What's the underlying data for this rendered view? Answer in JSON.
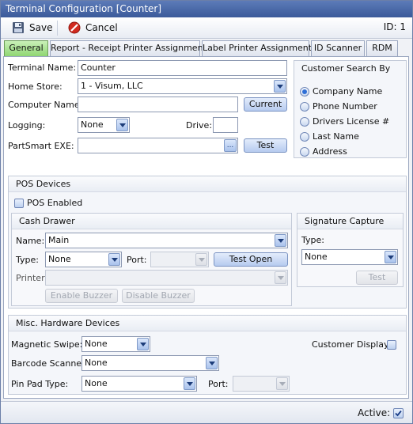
{
  "window": {
    "title": "Terminal Configuration [Counter]"
  },
  "toolbar": {
    "save_label": "Save",
    "cancel_label": "Cancel",
    "id_label": "ID: 1"
  },
  "tabs": [
    {
      "label": "General",
      "active": true
    },
    {
      "label": "Report - Receipt Printer Assignments"
    },
    {
      "label": "Label Printer Assignments"
    },
    {
      "label": "ID Scanner"
    },
    {
      "label": "RDM"
    }
  ],
  "general": {
    "terminal_name_label": "Terminal Name:",
    "terminal_name_value": "Counter",
    "home_store_label": "Home Store:",
    "home_store_value": "1 - Visum, LLC",
    "computer_name_label": "Computer Name:",
    "computer_name_value": "",
    "current_button": "Current",
    "logging_label": "Logging:",
    "logging_value": "None",
    "drive_label": "Drive:",
    "drive_value": "",
    "partsmart_label": "PartSmart EXE:",
    "partsmart_value": "",
    "browse_button": "...",
    "test_button": "Test"
  },
  "customer_search": {
    "title": "Customer Search By",
    "options": [
      "Company Name",
      "Phone Number",
      "Drivers License #",
      "Last Name",
      "Address"
    ],
    "selected": "Company Name"
  },
  "pos_devices": {
    "title": "POS Devices",
    "pos_enabled_label": "POS Enabled",
    "cash_drawer": {
      "title": "Cash Drawer",
      "name_label": "Name:",
      "name_value": "Main",
      "type_label": "Type:",
      "type_value": "None",
      "port_label": "Port:",
      "port_value": "",
      "test_open_button": "Test Open",
      "printer_label": "Printer:",
      "printer_value": "",
      "enable_buzzer_button": "Enable Buzzer",
      "disable_buzzer_button": "Disable Buzzer"
    },
    "signature_capture": {
      "title": "Signature Capture",
      "type_label": "Type:",
      "type_value": "None",
      "test_button": "Test"
    }
  },
  "misc_hardware": {
    "title": "Misc. Hardware Devices",
    "magnetic_swipe_label": "Magnetic Swipe:",
    "magnetic_swipe_value": "None",
    "customer_display_label": "Customer Display:",
    "barcode_scanner_label": "Barcode Scanner:",
    "barcode_scanner_value": "None",
    "pin_pad_label": "Pin Pad Type:",
    "pin_pad_value": "None",
    "port_label": "Port:",
    "port_value": ""
  },
  "status": {
    "active_label": "Active:",
    "active_checked": true
  }
}
